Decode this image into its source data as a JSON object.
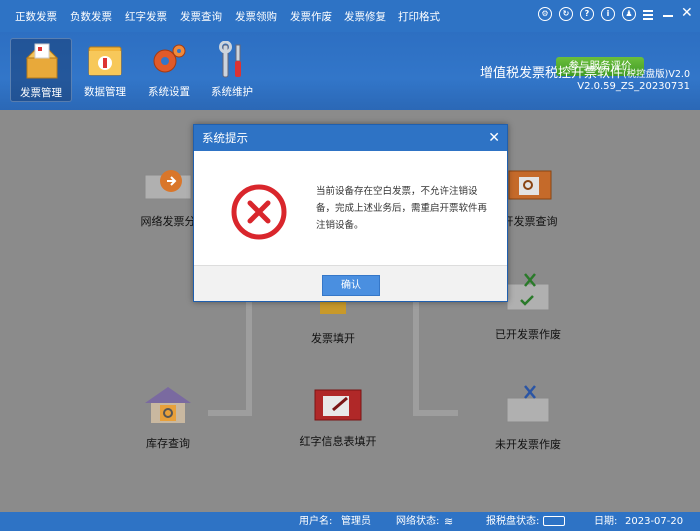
{
  "menu": {
    "items": [
      "正数发票",
      "负数发票",
      "红字发票",
      "发票查询",
      "发票领购",
      "发票作废",
      "发票修复",
      "打印格式"
    ]
  },
  "top_icons": [
    "settings-circle-icon",
    "refresh-circle-icon",
    "help-circle-icon",
    "info-circle-icon",
    "user-circle-icon",
    "menu-icon",
    "minimize-icon",
    "close-icon"
  ],
  "toolbar": {
    "tools": [
      {
        "label": "发票管理",
        "icon": "invoice-box-icon",
        "active": true
      },
      {
        "label": "数据管理",
        "icon": "data-folder-icon",
        "active": false
      },
      {
        "label": "系统设置",
        "icon": "gears-icon",
        "active": false
      },
      {
        "label": "系统维护",
        "icon": "tools-icon",
        "active": false
      }
    ],
    "eval_button": "参与服务评价",
    "app_title": "增值税发票税控开票软件",
    "app_title_suffix": "(税控盘版)V2.0",
    "app_version": "V2.0.59_ZS_20230731"
  },
  "flow": {
    "network_distribute": "网络发票分",
    "issued_query": "开发票查询",
    "invoice_fill": "发票填开",
    "issued_void": "已开发票作废",
    "stock_query": "库存查询",
    "red_info_fill": "红字信息表填开",
    "unissued_void": "未开发票作废"
  },
  "dialog": {
    "title": "系统提示",
    "message": "当前设备存在空白发票，不允许注销设备，完成上述业务后，需重启开票软件再注销设备。",
    "ok_label": "确认",
    "icon": "error-x-icon",
    "icon_color": "#d9262c"
  },
  "status": {
    "user_label": "用户名:",
    "user_value": "管理员",
    "network_label": "网络状态:",
    "tax_disk_label": "报税盘状态:",
    "date_label": "日期:",
    "date_value": "2023-07-20"
  },
  "colors": {
    "primary_blue": "#2e73c5",
    "eval_green": "#4fa92c",
    "ok_button": "#4a8fe0",
    "error_red": "#d9262c"
  }
}
